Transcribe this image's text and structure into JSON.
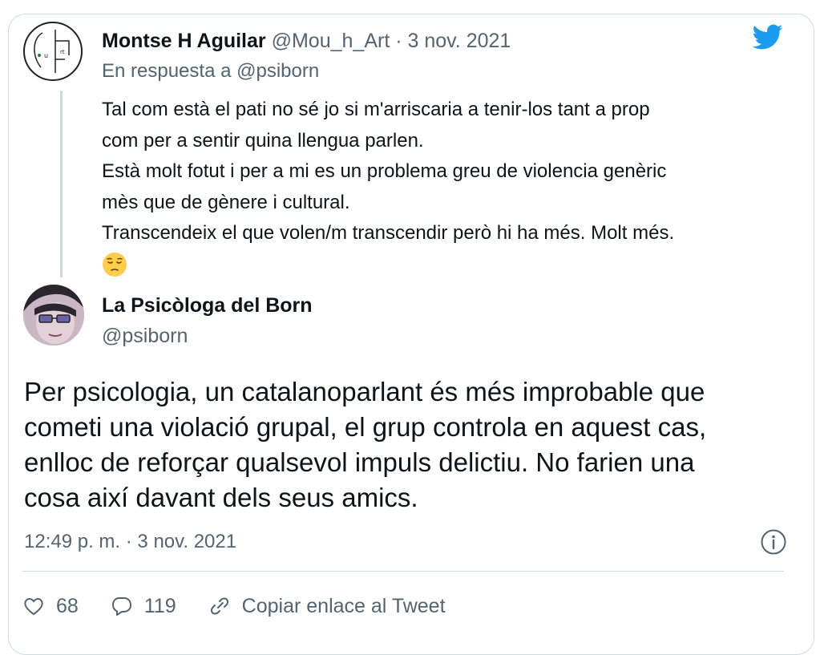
{
  "reply": {
    "author_name": "Montse H Aguilar",
    "author_handle": "@Mou_h_Art",
    "separator": "·",
    "date": "3 nov. 2021",
    "reply_prefix": "En respuesta a",
    "reply_handle": "@psiborn",
    "text_lines": [
      "Tal com està el pati no sé jo si m'arriscaria a tenir-los tant a prop",
      "com per a sentir quina llengua parlen.",
      "Està molt fotut i per a mi es un problema greu de violencia genèric",
      "mès que de gènere i cultural.",
      "Transcendeix el que volen/m transcendir però hi ha més. Molt més."
    ],
    "emoji": "pensive-face"
  },
  "main": {
    "author_name": "La Psicòloga del Born",
    "author_handle": "@psiborn",
    "text_lines": [
      "Per psicologia, un catalanoparlant és més improbable que",
      "cometi una violació grupal, el grup controla en aquest cas,",
      "enlloc de reforçar qualsevol impuls delictiu. No farien una",
      "cosa així davant dels seus amics."
    ],
    "time": "12:49 p. m.",
    "separator": "·",
    "date": "3 nov. 2021"
  },
  "actions": {
    "likes": "68",
    "replies": "119",
    "copy_link": "Copiar enlace al Tweet"
  },
  "colors": {
    "twitter_blue": "#1d9bf0",
    "muted": "#536471",
    "border": "#cfd9de"
  }
}
